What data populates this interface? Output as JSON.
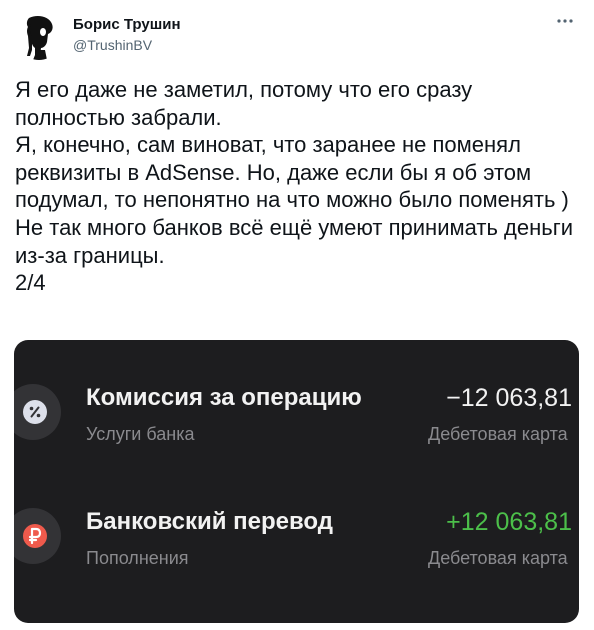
{
  "author": {
    "display_name": "Борис Трушин",
    "handle": "@TrushinBV"
  },
  "more_icon": "more-horizontal-icon",
  "tweet_lines": [
    "Я его даже не заметил, потому что его сразу полностью забрали.",
    "Я, конечно, сам виноват, что заранее не поменял реквизиты в AdSense. Но, даже если бы я об этом подумал, то непонятно на что можно было поменять )",
    "Не так много банков всё ещё умеют принимать деньги из-за границы.",
    "2/4"
  ],
  "media": {
    "background": "#1d1d1f",
    "operations": [
      {
        "icon": "percent-icon",
        "title": "Комиссия за операцию",
        "subtitle": "Услуги банка",
        "amount": "−12 063,81",
        "amount_color": "#f2f2f2",
        "card": "Дебетовая карта"
      },
      {
        "icon": "ruble-icon",
        "title": "Банковский перевод",
        "subtitle": "Пополнения",
        "amount": "+12 063,81",
        "amount_color": "#4cbf4a",
        "card": "Дебетовая карта"
      }
    ]
  }
}
